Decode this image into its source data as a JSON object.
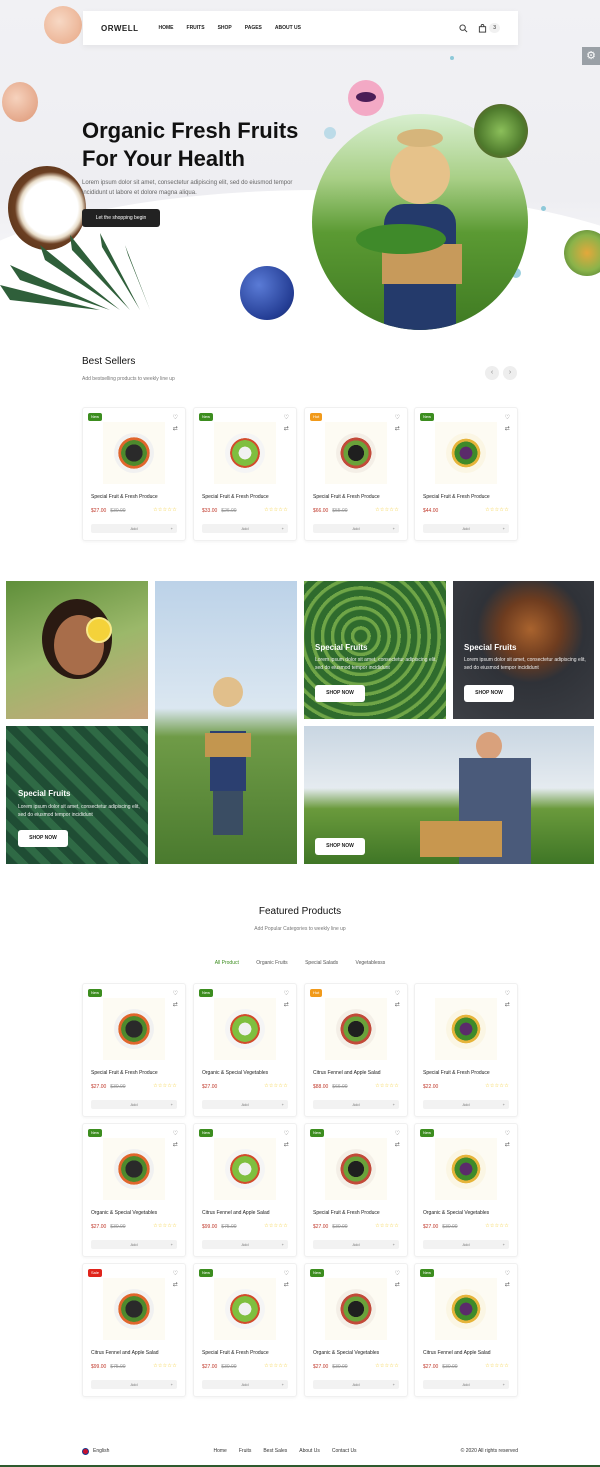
{
  "nav": {
    "logo": "ORWELL",
    "links": [
      "HOME",
      "FRUITS",
      "SHOP",
      "PAGES",
      "ABOUT US"
    ],
    "cart_count": "3"
  },
  "hero": {
    "title_line1": "Organic Fresh Fruits",
    "title_line2": "For Your Health",
    "text": "Lorem ipsum dolor sit amet, consectetur adipiscing elit, sed do eiusmod tempor incididunt ut labore et dolore magna aliqua.",
    "button": "Let the shopping begin"
  },
  "best_sellers": {
    "title": "Best Sellers",
    "subtitle": "Add bestselling products to weekly line up",
    "products": [
      {
        "badge": "New",
        "badge_type": "new",
        "name": "Special Fruit & Fresh Produce",
        "price": "$27.00",
        "old_price": "$30.00",
        "add": "Add"
      },
      {
        "badge": "New",
        "badge_type": "new",
        "name": "Special Fruit & Fresh Produce",
        "price": "$33.00",
        "old_price": "$26.00",
        "add": "Add"
      },
      {
        "badge": "Hot",
        "badge_type": "hot",
        "name": "Special Fruit & Fresh Produce",
        "price": "$66.00",
        "old_price": "$55.00",
        "add": "Add"
      },
      {
        "badge": "New",
        "badge_type": "new",
        "name": "Special Fruit & Fresh Produce",
        "price": "$44.00",
        "old_price": "",
        "add": "Add"
      }
    ]
  },
  "promo": {
    "tile_a": {
      "title": "Special Fruits",
      "text": "Lorem ipsum dolor sit amet, consectetur adipiscing elit, sed do eiusmod tempor incididunt",
      "button": "SHOP NOW"
    },
    "tile_b": {
      "title": "Special Fruits",
      "text": "Lorem ipsum dolor sit amet, consectetur adipiscing elit, sed do eiusmod tempor incididunt",
      "button": "SHOP NOW"
    },
    "tile_c": {
      "title": "Special Fruits",
      "text": "Lorem ipsum dolor sit amet, consectetur adipiscing elit, sed do eiusmod tempor incididunt",
      "button": "SHOP NOW"
    },
    "tile_d": {
      "button": "SHOP NOW"
    }
  },
  "featured": {
    "title": "Featured Products",
    "subtitle": "Add Popular Categories to weekly line up",
    "filters": [
      "All Product",
      "Organic Fruits",
      "Special Salads",
      "Vegetablesss"
    ],
    "products": [
      {
        "badge": "New",
        "badge_type": "new",
        "name": "Special Fruit & Fresh Produce",
        "price": "$27.00",
        "old_price": "$30.00",
        "add": "Add"
      },
      {
        "badge": "New",
        "badge_type": "new",
        "name": "Organic & Special Vegetables",
        "price": "$27.00",
        "old_price": "",
        "add": "Add"
      },
      {
        "badge": "Hot",
        "badge_type": "hot",
        "name": "Citrus Fennel and Apple Salad",
        "price": "$88.00",
        "old_price": "$66.00",
        "add": "Add"
      },
      {
        "badge": "",
        "badge_type": "",
        "name": "Special Fruit & Fresh Produce",
        "price": "$22.00",
        "old_price": "",
        "add": "Add"
      },
      {
        "badge": "New",
        "badge_type": "new",
        "name": "Organic & Special Vegetables",
        "price": "$27.00",
        "old_price": "$30.00",
        "add": "Add"
      },
      {
        "badge": "New",
        "badge_type": "new",
        "name": "Citrus Fennel and Apple Salad",
        "price": "$99.00",
        "old_price": "$75.00",
        "add": "Add"
      },
      {
        "badge": "New",
        "badge_type": "new",
        "name": "Special Fruit & Fresh Produce",
        "price": "$27.00",
        "old_price": "$30.00",
        "add": "Add"
      },
      {
        "badge": "New",
        "badge_type": "new",
        "name": "Organic & Special Vegetables",
        "price": "$27.00",
        "old_price": "$30.00",
        "add": "Add"
      },
      {
        "badge": "Sale",
        "badge_type": "sale",
        "name": "Citrus Fennel and Apple Salad",
        "price": "$99.00",
        "old_price": "$75.00",
        "add": "Add"
      },
      {
        "badge": "New",
        "badge_type": "new",
        "name": "Special Fruit & Fresh Produce",
        "price": "$27.00",
        "old_price": "$30.00",
        "add": "Add"
      },
      {
        "badge": "New",
        "badge_type": "new",
        "name": "Organic & Special Vegetables",
        "price": "$27.00",
        "old_price": "$30.00",
        "add": "Add"
      },
      {
        "badge": "New",
        "badge_type": "new",
        "name": "Citrus Fennel and Apple Salad",
        "price": "$27.00",
        "old_price": "$30.00",
        "add": "Add"
      }
    ]
  },
  "footer": {
    "language": "English",
    "links": [
      "Home",
      "Fruits",
      "Best Sales",
      "About Us",
      "Contact Us"
    ],
    "copyright": "© 2020 All rights reserved"
  },
  "colors": {
    "accent": "#3c8d1f",
    "hot": "#f19a1b",
    "sale": "#e0241b",
    "price": "#c0392b"
  }
}
